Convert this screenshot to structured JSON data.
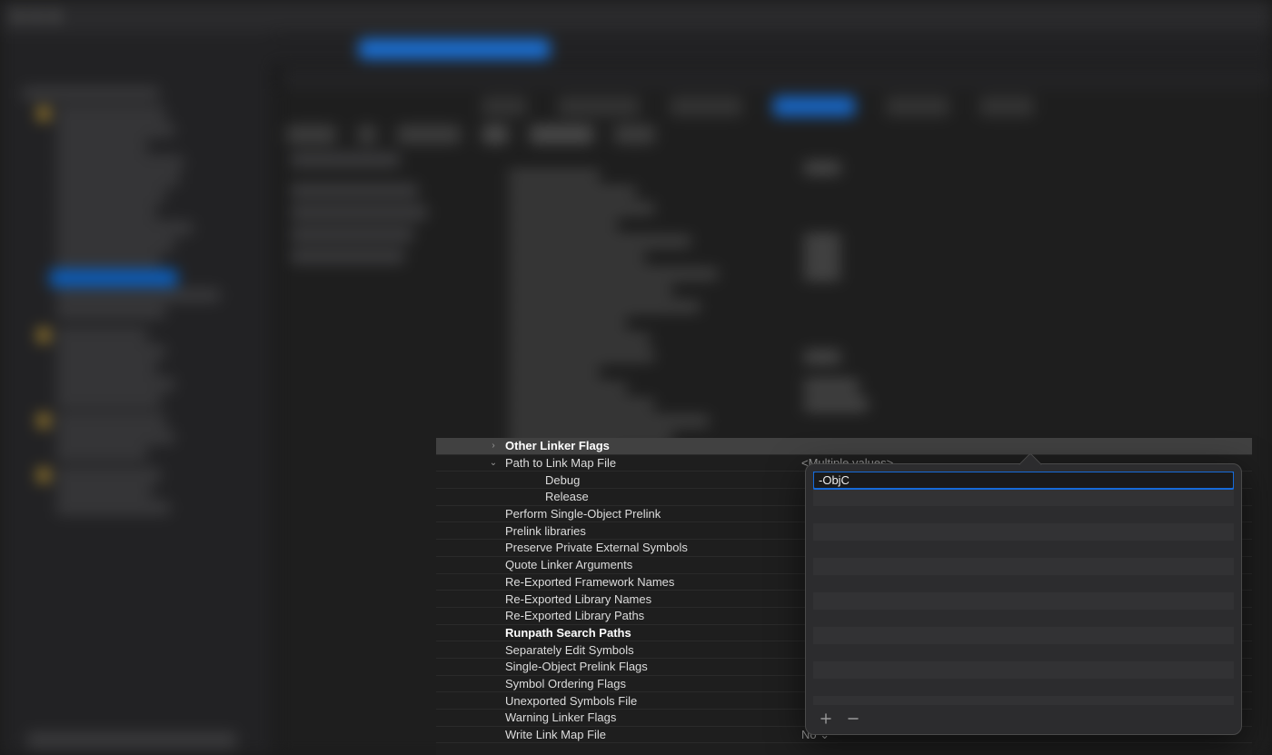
{
  "settings": {
    "rows": [
      {
        "label": "Other Linker Flags",
        "bold": true,
        "selected": true,
        "disclosure": "right",
        "value": ""
      },
      {
        "label": "Path to Link Map File",
        "bold": false,
        "disclosure": "down",
        "value": "<Multiple values>"
      },
      {
        "label": "Debug",
        "child": true
      },
      {
        "label": "Release",
        "child": true
      },
      {
        "label": "Perform Single-Object Prelink"
      },
      {
        "label": "Prelink libraries"
      },
      {
        "label": "Preserve Private External Symbols"
      },
      {
        "label": "Quote Linker Arguments"
      },
      {
        "label": "Re-Exported Framework Names"
      },
      {
        "label": "Re-Exported Library Names"
      },
      {
        "label": "Re-Exported Library Paths"
      },
      {
        "label": "Runpath Search Paths",
        "bold": true
      },
      {
        "label": "Separately Edit Symbols"
      },
      {
        "label": "Single-Object Prelink Flags"
      },
      {
        "label": "Symbol Ordering Flags"
      },
      {
        "label": "Unexported Symbols File"
      },
      {
        "label": "Warning Linker Flags"
      },
      {
        "label": "Write Link Map File",
        "value": "No ⌄"
      }
    ]
  },
  "popover": {
    "edit_value": "-ObjC"
  }
}
